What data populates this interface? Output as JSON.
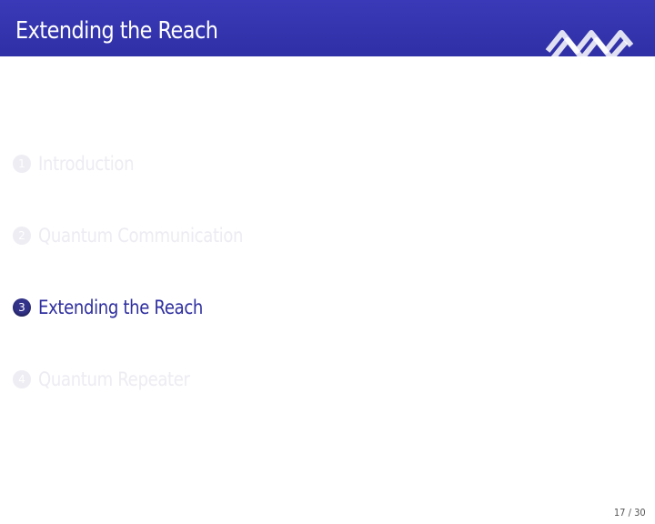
{
  "slide": {
    "title": "Extending the Reach",
    "page_number": "17 / 30"
  },
  "toc": [
    {
      "number": "1",
      "label": "Introduction",
      "active": false
    },
    {
      "number": "2",
      "label": "Quantum Communication",
      "active": false
    },
    {
      "number": "3",
      "label": "Extending the Reach",
      "active": true
    },
    {
      "number": "4",
      "label": "Quantum Repeater",
      "active": false
    }
  ],
  "colors": {
    "header": "#3434b0",
    "active_text": "#2f2fa0",
    "inactive_text": "#ececf2"
  },
  "icons": {
    "logo": "institution-logo-icon"
  }
}
